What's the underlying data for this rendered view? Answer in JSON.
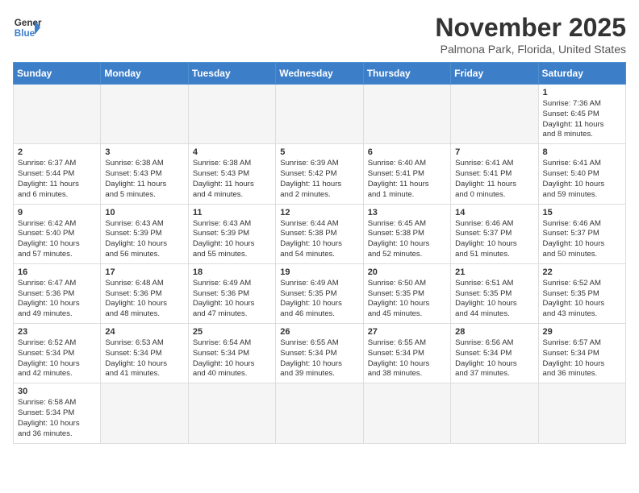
{
  "header": {
    "logo_line1": "General",
    "logo_line2": "Blue",
    "month_title": "November 2025",
    "location": "Palmona Park, Florida, United States"
  },
  "days_of_week": [
    "Sunday",
    "Monday",
    "Tuesday",
    "Wednesday",
    "Thursday",
    "Friday",
    "Saturday"
  ],
  "weeks": [
    [
      {
        "day": "",
        "info": ""
      },
      {
        "day": "",
        "info": ""
      },
      {
        "day": "",
        "info": ""
      },
      {
        "day": "",
        "info": ""
      },
      {
        "day": "",
        "info": ""
      },
      {
        "day": "",
        "info": ""
      },
      {
        "day": "1",
        "info": "Sunrise: 7:36 AM\nSunset: 6:45 PM\nDaylight: 11 hours\nand 8 minutes."
      }
    ],
    [
      {
        "day": "2",
        "info": "Sunrise: 6:37 AM\nSunset: 5:44 PM\nDaylight: 11 hours\nand 6 minutes."
      },
      {
        "day": "3",
        "info": "Sunrise: 6:38 AM\nSunset: 5:43 PM\nDaylight: 11 hours\nand 5 minutes."
      },
      {
        "day": "4",
        "info": "Sunrise: 6:38 AM\nSunset: 5:43 PM\nDaylight: 11 hours\nand 4 minutes."
      },
      {
        "day": "5",
        "info": "Sunrise: 6:39 AM\nSunset: 5:42 PM\nDaylight: 11 hours\nand 2 minutes."
      },
      {
        "day": "6",
        "info": "Sunrise: 6:40 AM\nSunset: 5:41 PM\nDaylight: 11 hours\nand 1 minute."
      },
      {
        "day": "7",
        "info": "Sunrise: 6:41 AM\nSunset: 5:41 PM\nDaylight: 11 hours\nand 0 minutes."
      },
      {
        "day": "8",
        "info": "Sunrise: 6:41 AM\nSunset: 5:40 PM\nDaylight: 10 hours\nand 59 minutes."
      }
    ],
    [
      {
        "day": "9",
        "info": "Sunrise: 6:42 AM\nSunset: 5:40 PM\nDaylight: 10 hours\nand 57 minutes."
      },
      {
        "day": "10",
        "info": "Sunrise: 6:43 AM\nSunset: 5:39 PM\nDaylight: 10 hours\nand 56 minutes."
      },
      {
        "day": "11",
        "info": "Sunrise: 6:43 AM\nSunset: 5:39 PM\nDaylight: 10 hours\nand 55 minutes."
      },
      {
        "day": "12",
        "info": "Sunrise: 6:44 AM\nSunset: 5:38 PM\nDaylight: 10 hours\nand 54 minutes."
      },
      {
        "day": "13",
        "info": "Sunrise: 6:45 AM\nSunset: 5:38 PM\nDaylight: 10 hours\nand 52 minutes."
      },
      {
        "day": "14",
        "info": "Sunrise: 6:46 AM\nSunset: 5:37 PM\nDaylight: 10 hours\nand 51 minutes."
      },
      {
        "day": "15",
        "info": "Sunrise: 6:46 AM\nSunset: 5:37 PM\nDaylight: 10 hours\nand 50 minutes."
      }
    ],
    [
      {
        "day": "16",
        "info": "Sunrise: 6:47 AM\nSunset: 5:36 PM\nDaylight: 10 hours\nand 49 minutes."
      },
      {
        "day": "17",
        "info": "Sunrise: 6:48 AM\nSunset: 5:36 PM\nDaylight: 10 hours\nand 48 minutes."
      },
      {
        "day": "18",
        "info": "Sunrise: 6:49 AM\nSunset: 5:36 PM\nDaylight: 10 hours\nand 47 minutes."
      },
      {
        "day": "19",
        "info": "Sunrise: 6:49 AM\nSunset: 5:35 PM\nDaylight: 10 hours\nand 46 minutes."
      },
      {
        "day": "20",
        "info": "Sunrise: 6:50 AM\nSunset: 5:35 PM\nDaylight: 10 hours\nand 45 minutes."
      },
      {
        "day": "21",
        "info": "Sunrise: 6:51 AM\nSunset: 5:35 PM\nDaylight: 10 hours\nand 44 minutes."
      },
      {
        "day": "22",
        "info": "Sunrise: 6:52 AM\nSunset: 5:35 PM\nDaylight: 10 hours\nand 43 minutes."
      }
    ],
    [
      {
        "day": "23",
        "info": "Sunrise: 6:52 AM\nSunset: 5:34 PM\nDaylight: 10 hours\nand 42 minutes."
      },
      {
        "day": "24",
        "info": "Sunrise: 6:53 AM\nSunset: 5:34 PM\nDaylight: 10 hours\nand 41 minutes."
      },
      {
        "day": "25",
        "info": "Sunrise: 6:54 AM\nSunset: 5:34 PM\nDaylight: 10 hours\nand 40 minutes."
      },
      {
        "day": "26",
        "info": "Sunrise: 6:55 AM\nSunset: 5:34 PM\nDaylight: 10 hours\nand 39 minutes."
      },
      {
        "day": "27",
        "info": "Sunrise: 6:55 AM\nSunset: 5:34 PM\nDaylight: 10 hours\nand 38 minutes."
      },
      {
        "day": "28",
        "info": "Sunrise: 6:56 AM\nSunset: 5:34 PM\nDaylight: 10 hours\nand 37 minutes."
      },
      {
        "day": "29",
        "info": "Sunrise: 6:57 AM\nSunset: 5:34 PM\nDaylight: 10 hours\nand 36 minutes."
      }
    ],
    [
      {
        "day": "30",
        "info": "Sunrise: 6:58 AM\nSunset: 5:34 PM\nDaylight: 10 hours\nand 36 minutes."
      },
      {
        "day": "",
        "info": ""
      },
      {
        "day": "",
        "info": ""
      },
      {
        "day": "",
        "info": ""
      },
      {
        "day": "",
        "info": ""
      },
      {
        "day": "",
        "info": ""
      },
      {
        "day": "",
        "info": ""
      }
    ]
  ]
}
